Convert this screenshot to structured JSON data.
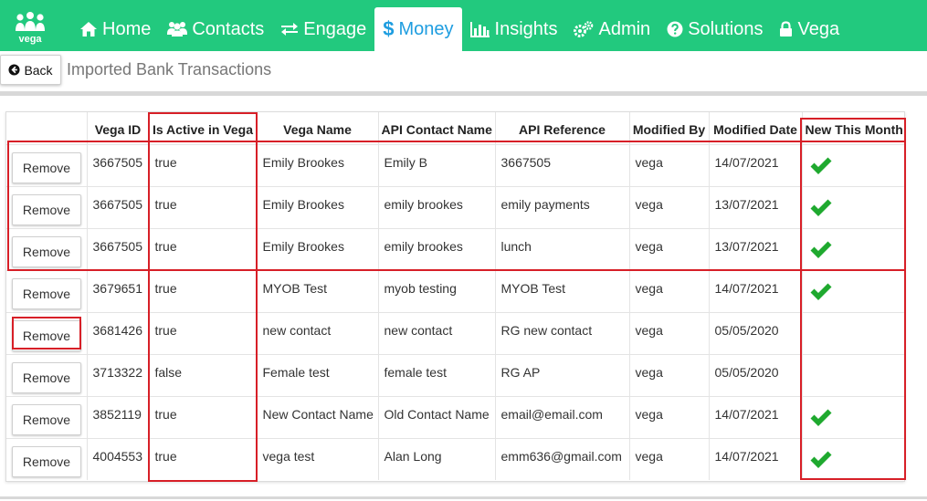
{
  "nav": {
    "logo_text": "vega",
    "items": [
      {
        "label": "Home",
        "icon": "home-icon"
      },
      {
        "label": "Contacts",
        "icon": "users-icon"
      },
      {
        "label": "Engage",
        "icon": "exchange-icon"
      },
      {
        "label": "Money",
        "icon": "dollar-icon"
      },
      {
        "label": "Insights",
        "icon": "bar-chart-icon"
      },
      {
        "label": "Admin",
        "icon": "gears-icon"
      },
      {
        "label": "Solutions",
        "icon": "question-circle-icon"
      },
      {
        "label": "Vega",
        "icon": "lock-icon"
      }
    ],
    "active_index": 3
  },
  "header": {
    "back_label": "Back",
    "title": "Imported Bank Transactions"
  },
  "table": {
    "columns": [
      "",
      "Vega ID",
      "Is Active in Vega",
      "Vega Name",
      "API Contact Name",
      "API Reference",
      "Modified By",
      "Modified Date",
      "New This Month"
    ],
    "remove_label": "Remove",
    "rows": [
      {
        "vega_id": "3667505",
        "active": "true",
        "vega_name": "Emily Brookes",
        "api_contact": "Emily B",
        "api_ref": "3667505",
        "modified_by": "vega",
        "modified_date": "14/07/2021",
        "new_this_month": true
      },
      {
        "vega_id": "3667505",
        "active": "true",
        "vega_name": "Emily Brookes",
        "api_contact": "emily brookes",
        "api_ref": "emily payments",
        "modified_by": "vega",
        "modified_date": "13/07/2021",
        "new_this_month": true
      },
      {
        "vega_id": "3667505",
        "active": "true",
        "vega_name": "Emily Brookes",
        "api_contact": "emily brookes",
        "api_ref": "lunch",
        "modified_by": "vega",
        "modified_date": "13/07/2021",
        "new_this_month": true
      },
      {
        "vega_id": "3679651",
        "active": "true",
        "vega_name": "MYOB Test",
        "api_contact": "myob testing",
        "api_ref": "MYOB Test",
        "modified_by": "vega",
        "modified_date": "14/07/2021",
        "new_this_month": true
      },
      {
        "vega_id": "3681426",
        "active": "true",
        "vega_name": "new contact",
        "api_contact": "new contact",
        "api_ref": "RG new contact",
        "modified_by": "vega",
        "modified_date": "05/05/2020",
        "new_this_month": false
      },
      {
        "vega_id": "3713322",
        "active": "false",
        "vega_name": "Female test",
        "api_contact": "female test",
        "api_ref": "RG AP",
        "modified_by": "vega",
        "modified_date": "05/05/2020",
        "new_this_month": false
      },
      {
        "vega_id": "3852119",
        "active": "true",
        "vega_name": "New Contact Name",
        "api_contact": "Old Contact Name",
        "api_ref": "email@email.com",
        "modified_by": "vega",
        "modified_date": "14/07/2021",
        "new_this_month": true
      },
      {
        "vega_id": "4004553",
        "active": "true",
        "vega_name": "vega test",
        "api_contact": "Alan Long",
        "api_ref": "emm636@gmail.com",
        "modified_by": "vega",
        "modified_date": "14/07/2021",
        "new_this_month": true
      }
    ]
  },
  "colors": {
    "nav_bg": "#22c97e",
    "active_tab_text": "#1e9de0",
    "highlight_border": "#d71f27",
    "check_green": "#1fa92f"
  }
}
